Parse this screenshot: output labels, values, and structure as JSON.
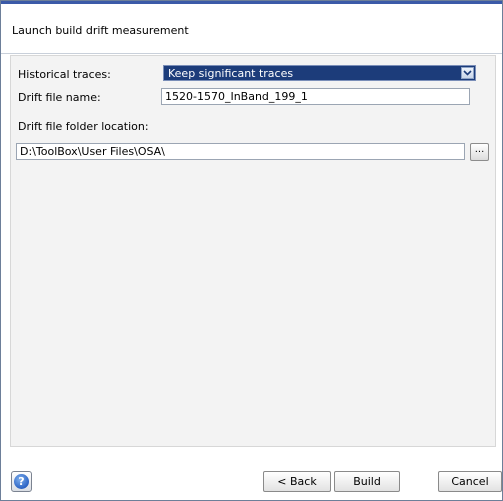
{
  "dialog": {
    "title": "Launch build drift measurement"
  },
  "form": {
    "historical_traces_label": "Historical traces:",
    "historical_traces_value": "Keep significant traces",
    "drift_file_name_label": "Drift file name:",
    "drift_file_name_value": "1520-1570_InBand_199_1",
    "folder_location_label": "Drift file folder location:",
    "folder_location_value": "D:\\ToolBox\\User Files\\OSA\\",
    "browse_label": "..."
  },
  "footer": {
    "help_label": "?",
    "back_label": "< Back",
    "build_label": "Build",
    "cancel_label": "Cancel"
  },
  "icons": {
    "help": "help-icon",
    "dropdown": "chevron-down-icon"
  },
  "colors": {
    "accent": "#3b5aa8",
    "select_bg": "#1c3c7a",
    "content_bg": "#f3f3f3"
  }
}
